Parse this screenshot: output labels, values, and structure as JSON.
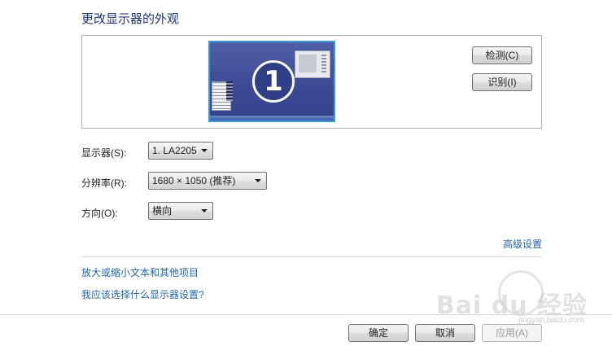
{
  "page": {
    "title": "更改显示器的外观"
  },
  "preview": {
    "monitor_number": "1",
    "detect_button": "检测(C)",
    "identify_button": "识别(I)"
  },
  "settings": {
    "display_label": "显示器(S):",
    "display_value": "1. LA2205",
    "resolution_label": "分辨率(R):",
    "resolution_value": "1680 × 1050 (推荐)",
    "orientation_label": "方向(O):",
    "orientation_value": "横向"
  },
  "links": {
    "advanced": "高级设置",
    "text_size": "放大或缩小文本和其他项目",
    "help": "我应该选择什么显示器设置?"
  },
  "footer": {
    "ok_button": "确定",
    "cancel_button": "取消",
    "apply_button": "应用(A)"
  },
  "watermark": {
    "text": "Bai du 经验",
    "url": "jingyan.baidu.com"
  }
}
